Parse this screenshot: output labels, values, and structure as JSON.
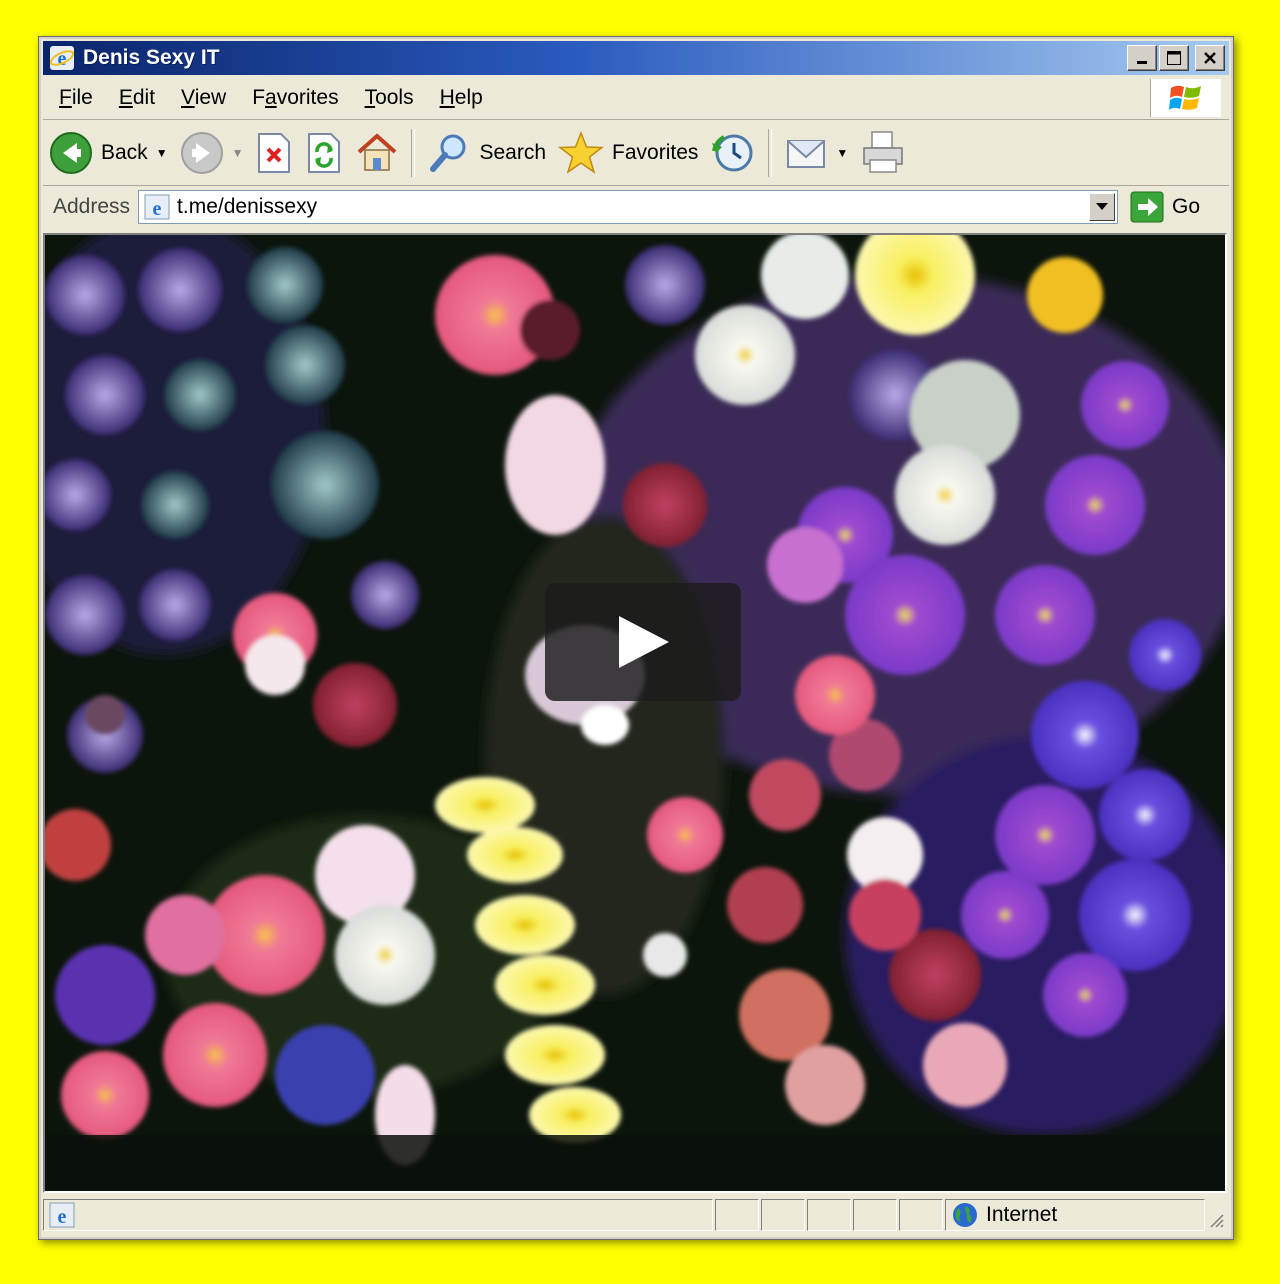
{
  "window": {
    "title": "Denis Sexy IT"
  },
  "menu": {
    "items": [
      "File",
      "Edit",
      "View",
      "Favorites",
      "Tools",
      "Help"
    ],
    "accel": [
      "F",
      "E",
      "V",
      "a",
      "T",
      "H"
    ]
  },
  "toolbar": {
    "back_label": "Back",
    "search_label": "Search",
    "favorites_label": "Favorites"
  },
  "address": {
    "label": "Address",
    "url": "t.me/denissexy",
    "go_label": "Go"
  },
  "status": {
    "zone": "Internet"
  },
  "icons": {
    "title": "ie-icon",
    "back": "back-arrow-icon",
    "forward": "forward-arrow-icon",
    "stop": "stop-icon",
    "refresh": "refresh-icon",
    "home": "home-icon",
    "search": "search-magnifier-icon",
    "favorites": "favorites-star-icon",
    "history": "history-icon",
    "mail": "mail-icon",
    "print": "print-icon",
    "zone": "globe-icon"
  },
  "colors": {
    "background": "#ffff00",
    "titlebar_start": "#0a246a",
    "titlebar_end": "#a6caf0",
    "chrome": "#ece9d8"
  }
}
